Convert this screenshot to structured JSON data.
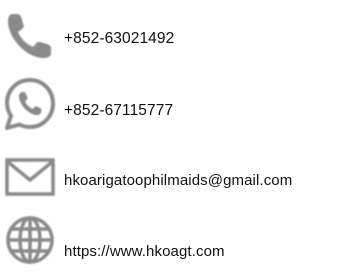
{
  "contacts": {
    "phone": {
      "icon": "phone-icon",
      "text": "+852-63021492"
    },
    "whatsapp": {
      "icon": "whatsapp-icon",
      "text": "+852-67115777"
    },
    "email": {
      "icon": "envelope-icon",
      "text": "hkoarigatoophilmaids@gmail.com"
    },
    "website": {
      "icon": "globe-icon",
      "text": "https://www.hkoagt.com"
    }
  },
  "colors": {
    "icon": "#8a8a8a",
    "text": "#111111",
    "background": "#ffffff"
  }
}
